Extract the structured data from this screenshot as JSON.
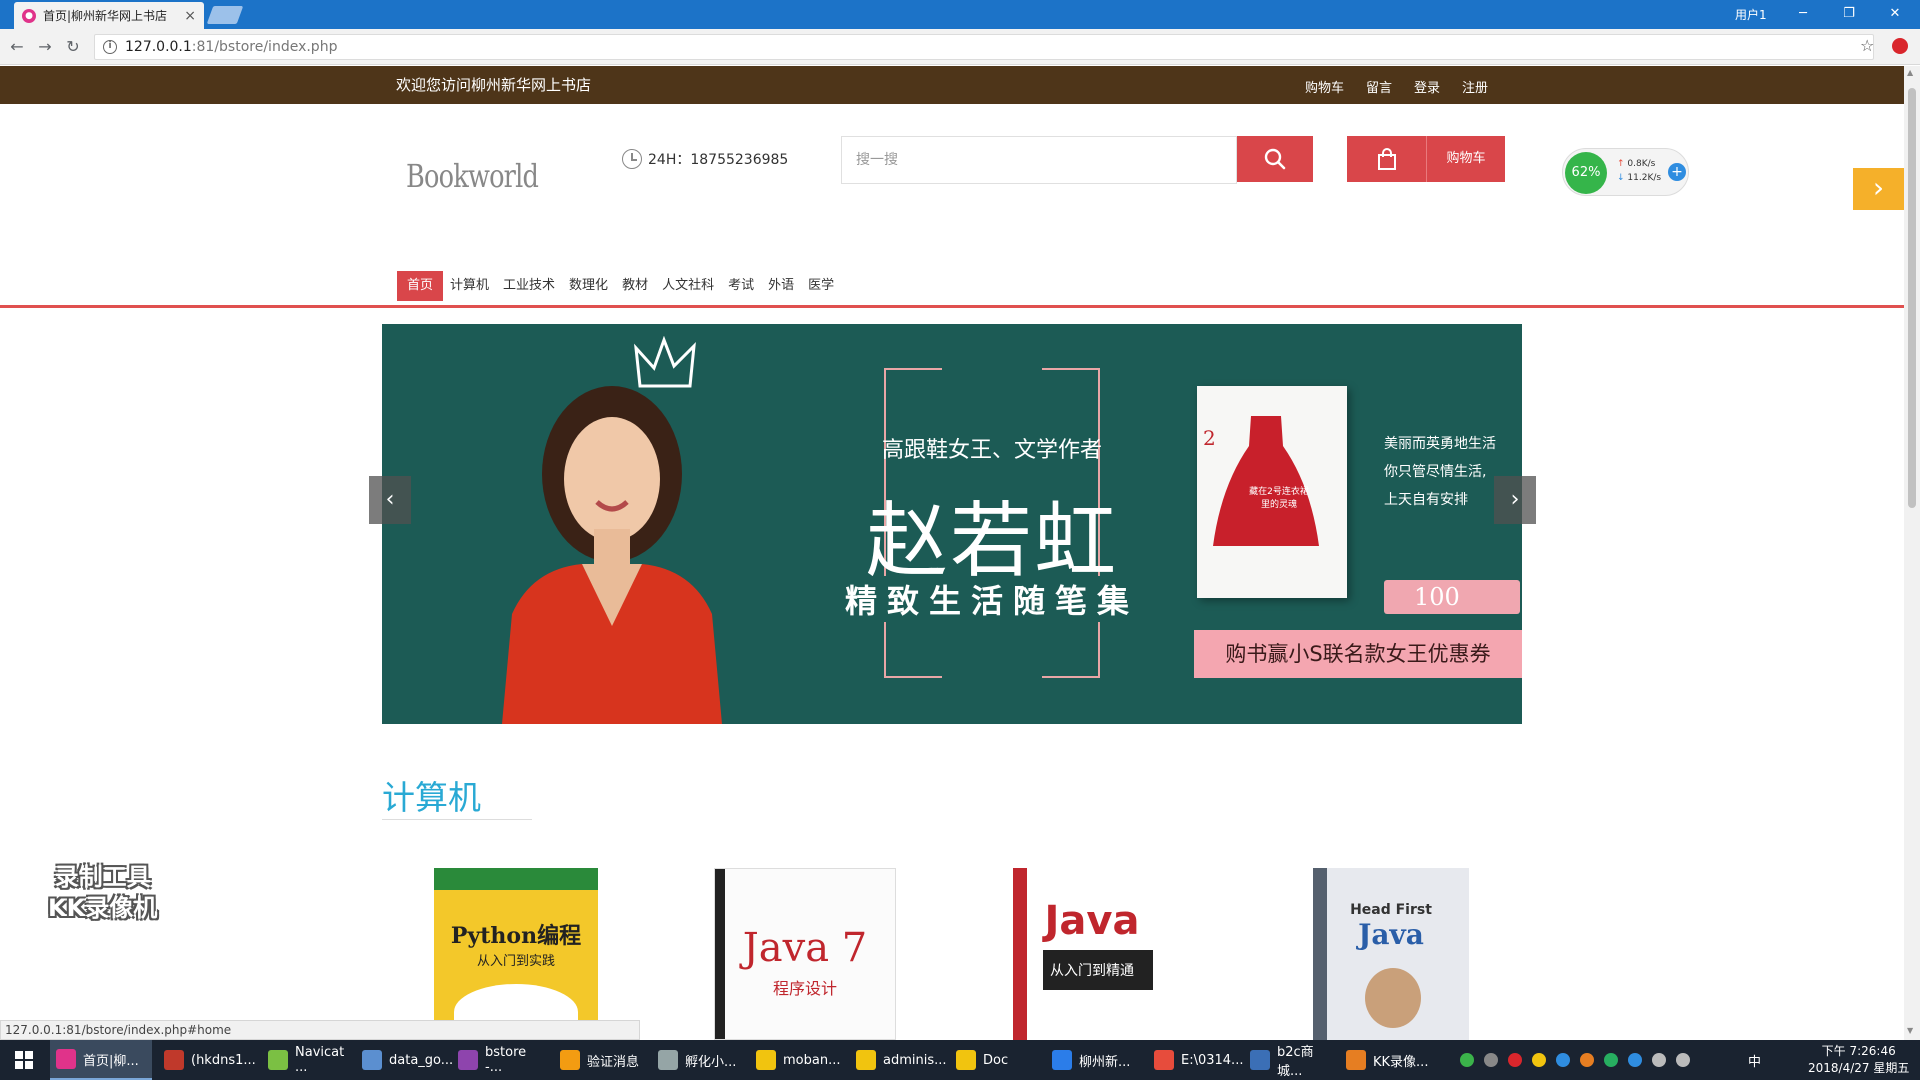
{
  "browser": {
    "tab_title": "首页|柳州新华网上书店",
    "tab_close": "×",
    "window_user": "用户1",
    "url_host": "127.0.0.1",
    "url_path": ":81/bstore/index.php",
    "status_url": "127.0.0.1:81/bstore/index.php#home"
  },
  "site": {
    "welcome": "欢迎您访问柳州新华网上书店",
    "top_links": [
      "购物车",
      "留言",
      "登录",
      "注册"
    ],
    "logo": "Bookworld",
    "hotline": "24H：18755236985",
    "search_placeholder": "搜一搜",
    "cart_label": "购物车",
    "categories": [
      "首页",
      "计算机",
      "工业技术",
      "数理化",
      "教材",
      "人文社科",
      "考试",
      "外语",
      "医学"
    ],
    "section_title": "计算机"
  },
  "banner": {
    "subtitle": "高跟鞋女王、文学作者",
    "author": "赵若虹",
    "series": "精致生活随笔集",
    "book_number": "2",
    "book_title": "藏在2号连衣裙里的灵魂",
    "slogan": [
      "美丽而英勇地生活",
      "你只管尽情生活,",
      "上天自有安排"
    ],
    "voucher": "100",
    "promo": "购书赢小S联名款女王优惠券"
  },
  "books": [
    {
      "title": "Python编程",
      "subtitle": "从入门到实践"
    },
    {
      "title": "Java 7",
      "subtitle": "程序设计"
    },
    {
      "title": "Java",
      "subtitle": "从入门到精通"
    },
    {
      "title": "Head First",
      "subtitle": "Java"
    }
  ],
  "netmonitor": {
    "percent": "62%",
    "up": "0.8K/s",
    "down": "11.2K/s"
  },
  "watermark": [
    "录制工具",
    "KK录像机"
  ],
  "taskbar": {
    "tasks": [
      {
        "label": "首页|柳...",
        "color": "#e0338a"
      },
      {
        "label": "(hkdns1...",
        "color": "#c0392b"
      },
      {
        "label": "Navicat ...",
        "color": "#7bc043"
      },
      {
        "label": "data_go...",
        "color": "#5b8fd0"
      },
      {
        "label": "bstore -...",
        "color": "#8e44ad"
      },
      {
        "label": "验证消息",
        "color": "#f39c12"
      },
      {
        "label": "孵化小...",
        "color": "#95a5a6"
      },
      {
        "label": "moban...",
        "color": "#f1c40f"
      },
      {
        "label": "adminis...",
        "color": "#f1c40f"
      },
      {
        "label": "Doc",
        "color": "#f1c40f"
      },
      {
        "label": "柳州新...",
        "color": "#2b7de9"
      },
      {
        "label": "E:\\0314...",
        "color": "#e74c3c"
      },
      {
        "label": "b2c商城...",
        "color": "#3b6fb6"
      },
      {
        "label": "KK录像...",
        "color": "#e67e22"
      }
    ],
    "ime": "中",
    "time": "下午 7:26:46",
    "date": "2018/4/27 星期五"
  }
}
